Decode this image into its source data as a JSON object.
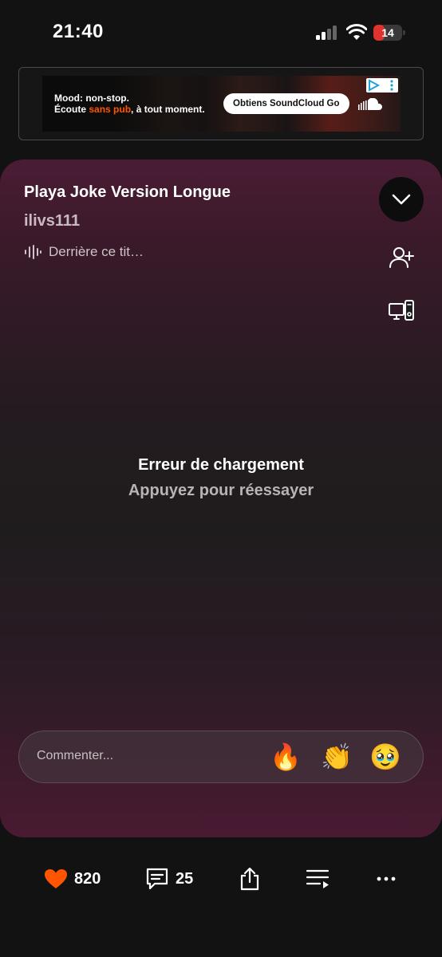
{
  "status_bar": {
    "time": "21:40",
    "battery_level": "14",
    "battery_color": "#e0332e"
  },
  "ad": {
    "line1": "Mood: non-stop.",
    "line2_start": "Écoute ",
    "line2_highlight": "sans pub",
    "line2_end": ", à tout moment.",
    "cta": "Obtiens SoundCloud Go",
    "accent_color": "#ff5500"
  },
  "player": {
    "title": "Playa Joke Version Longue",
    "artist": "ilivs111",
    "behind_track": "Derrière ce tit…",
    "error_title": "Erreur de chargement",
    "error_subtitle": "Appuyez pour réessayer",
    "comment_placeholder": "Commenter...",
    "reactions": [
      "🔥",
      "👏",
      "🥹"
    ]
  },
  "toolbar": {
    "likes": "820",
    "comments": "25",
    "like_color": "#ff5500"
  },
  "icons": [
    "wave-icon",
    "chevron-down-icon",
    "follow-user-icon",
    "device-cast-icon",
    "heart-icon",
    "comment-icon",
    "share-icon",
    "queue-icon",
    "more-icon"
  ]
}
